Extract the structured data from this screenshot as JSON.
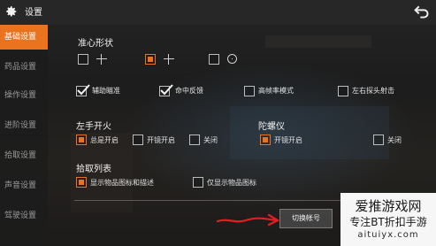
{
  "header": {
    "title": "设置",
    "settings_icon": "gear-icon",
    "back_icon": "back-arrow-icon"
  },
  "sidebar": {
    "items": [
      {
        "label": "基础设置",
        "active": true
      },
      {
        "label": "药品设置",
        "active": false
      },
      {
        "label": "操作设置",
        "active": false
      },
      {
        "label": "进阶设置",
        "active": false
      },
      {
        "label": "拾取设置",
        "active": false
      },
      {
        "label": "声音设置",
        "active": false
      },
      {
        "label": "驾驶设置",
        "active": false
      }
    ]
  },
  "crosshair": {
    "title": "准心形状",
    "options": [
      {
        "icon": "crosshair-cross-icon",
        "checked": false
      },
      {
        "icon": "crosshair-dot-cross-icon",
        "checked": true
      },
      {
        "icon": "crosshair-circle-icon",
        "checked": false
      }
    ]
  },
  "aim_options": [
    {
      "label": "辅助瞄准",
      "checked": true
    },
    {
      "label": "命中反馈",
      "checked": true
    },
    {
      "label": "高帧率模式",
      "checked": false
    },
    {
      "label": "左右探头射击",
      "checked": false
    }
  ],
  "left_fire": {
    "title": "左手开火",
    "options": [
      {
        "label": "总是开启",
        "checked": true
      },
      {
        "label": "开镜开启",
        "checked": false
      },
      {
        "label": "关闭",
        "checked": false
      }
    ]
  },
  "gyroscope": {
    "title": "陀螺仪",
    "options": [
      {
        "label": "开镜开启",
        "checked": true
      },
      {
        "label": "关闭",
        "checked": false
      }
    ]
  },
  "pickup_list": {
    "title": "拾取列表",
    "options": [
      {
        "label": "显示物品图标和描述",
        "checked": true
      },
      {
        "label": "仅显示物品图标",
        "checked": false
      }
    ]
  },
  "footer": {
    "switch_account_label": "切换帐号"
  },
  "watermark": {
    "line1": "爱推游戏网",
    "line2": "专注BT折扣手游",
    "line3": "aituiyx.com"
  },
  "colors": {
    "accent": "#e9731f",
    "annotation_arrow": "#e02020"
  }
}
